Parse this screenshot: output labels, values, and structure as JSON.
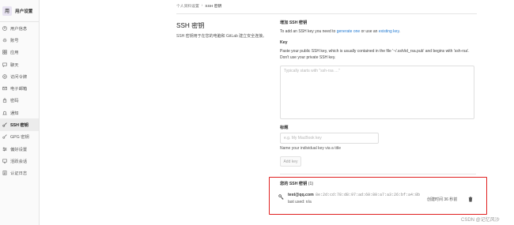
{
  "sidebar": {
    "avatar_letter": "用",
    "title": "用户设置",
    "items": [
      {
        "label": "用户信息",
        "icon": "user-icon"
      },
      {
        "label": "账号",
        "icon": "gear-icon"
      },
      {
        "label": "应用",
        "icon": "apps-icon"
      },
      {
        "label": "聊天",
        "icon": "chat-icon"
      },
      {
        "label": "访问令牌",
        "icon": "token-icon"
      },
      {
        "label": "电子邮箱",
        "icon": "mail-icon"
      },
      {
        "label": "密码",
        "icon": "lock-icon"
      },
      {
        "label": "通知",
        "icon": "bell-icon"
      },
      {
        "label": "SSH 密钥",
        "icon": "key-icon",
        "active": true
      },
      {
        "label": "GPG 密钥",
        "icon": "key-icon"
      },
      {
        "label": "偏好设置",
        "icon": "preferences-icon"
      },
      {
        "label": "活跃会话",
        "icon": "monitor-icon"
      },
      {
        "label": "认证日志",
        "icon": "list-icon"
      }
    ]
  },
  "breadcrumb": {
    "parent": "个人资料设置",
    "separator": "›",
    "current": "SSH 密钥"
  },
  "left": {
    "title": "SSH 密钥",
    "description": "SSH 密钥用于在您的电脑和 GitLab 建立安全连接。"
  },
  "form": {
    "title": "增加 SSH 密钥",
    "intro_prefix": "To add an SSH key you need to ",
    "intro_link1": "generate one",
    "intro_middle": " or use an ",
    "intro_link2": "existing key",
    "intro_suffix": ".",
    "key_label": "Key",
    "key_help": "Paste your public SSH key, which is usually contained in the file '~/.ssh/id_rsa.pub' and begins with 'ssh-rsa'. Don't use your private SSH key.",
    "key_placeholder": "Typically starts with \"ssh-rsa …\"",
    "title_label": "标题",
    "title_placeholder": "e.g. My MacBook key",
    "title_help": "Name your individual key via a title",
    "add_button": "Add key"
  },
  "keys": {
    "heading": "您的 SSH 密钥",
    "count": "(1)",
    "items": [
      {
        "title": "test@qq.com",
        "fingerprint": "8e:2d:cd:78:d8:97:ad:60:80:a7:a3:26:bf:a4:8b",
        "last_used": "last used: n/a",
        "created": "创建时间 36 秒前"
      }
    ]
  },
  "colors": {
    "link": "#1f78d1",
    "highlight": "#e02020",
    "sidebar_bg": "#fafafa"
  },
  "watermark": "CSDN @记忆风沙"
}
